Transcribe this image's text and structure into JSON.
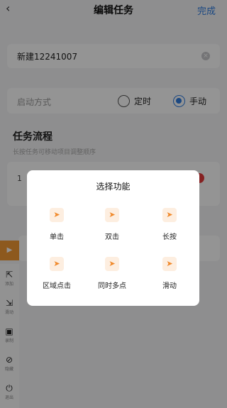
{
  "header": {
    "title": "编辑任务",
    "back_icon": "chevron-left-icon",
    "done_label": "完成"
  },
  "task_name": {
    "value": "新建12241007",
    "clear_icon": "clear-circle-icon"
  },
  "start_mode": {
    "label": "启动方式",
    "options": [
      {
        "label": "定时",
        "selected": false
      },
      {
        "label": "手动",
        "selected": true
      }
    ],
    "accent": "#2f7de1"
  },
  "flow": {
    "title": "任务流程",
    "hint": "长按任务可移动项目调整顺序",
    "items": [
      {
        "index": "1"
      }
    ]
  },
  "side_toolbar": {
    "play_icon": "play-icon",
    "accent": "#f39a35",
    "tools": [
      {
        "icon": "add-tap-icon",
        "label": "添加"
      },
      {
        "icon": "swipe-icon",
        "label": "滑动"
      },
      {
        "icon": "record-icon",
        "label": "录制"
      },
      {
        "icon": "hide-icon",
        "label": "隐藏"
      },
      {
        "icon": "power-icon",
        "label": "退出"
      }
    ]
  },
  "dialog": {
    "title": "选择功能",
    "functions": [
      {
        "label": "单击",
        "icon": "tap-icon"
      },
      {
        "label": "双击",
        "icon": "double-tap-icon"
      },
      {
        "label": "长按",
        "icon": "long-press-icon"
      },
      {
        "label": "区域点击",
        "icon": "area-tap-icon"
      },
      {
        "label": "同时多点",
        "icon": "multi-tap-icon"
      },
      {
        "label": "滑动",
        "icon": "swipe-icon"
      }
    ],
    "icon_color": "#f08a2c"
  }
}
